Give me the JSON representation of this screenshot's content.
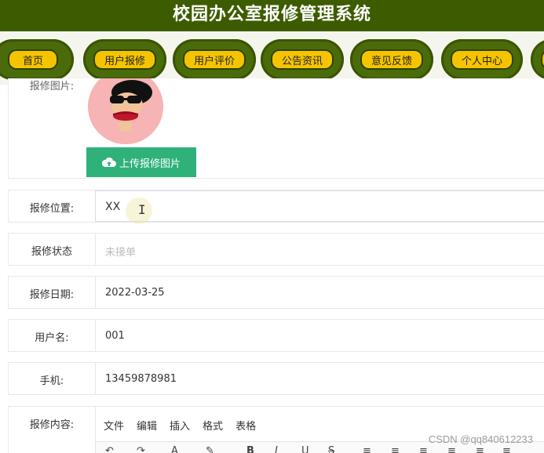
{
  "header": {
    "title": "校园办公室报修管理系统"
  },
  "nav": {
    "items": [
      {
        "label": "首页"
      },
      {
        "label": "用户报修"
      },
      {
        "label": "用户评价"
      },
      {
        "label": "公告资讯"
      },
      {
        "label": "意见反馈"
      },
      {
        "label": "个人中心"
      }
    ]
  },
  "form": {
    "image": {
      "label": "报修图片:",
      "upload_button": "上传报修图片"
    },
    "location": {
      "label": "报修位置:",
      "value": "XX"
    },
    "status": {
      "label": "报修状态",
      "placeholder": "未接单"
    },
    "date": {
      "label": "报修日期:",
      "value": "2022-03-25"
    },
    "username": {
      "label": "用户名:",
      "value": "001"
    },
    "phone": {
      "label": "手机:",
      "value": "13459878981"
    },
    "content": {
      "label": "报修内容:",
      "editor_menu": [
        "文件",
        "编辑",
        "插入",
        "格式",
        "表格"
      ]
    }
  },
  "watermark": "CSDN @qq840612233"
}
